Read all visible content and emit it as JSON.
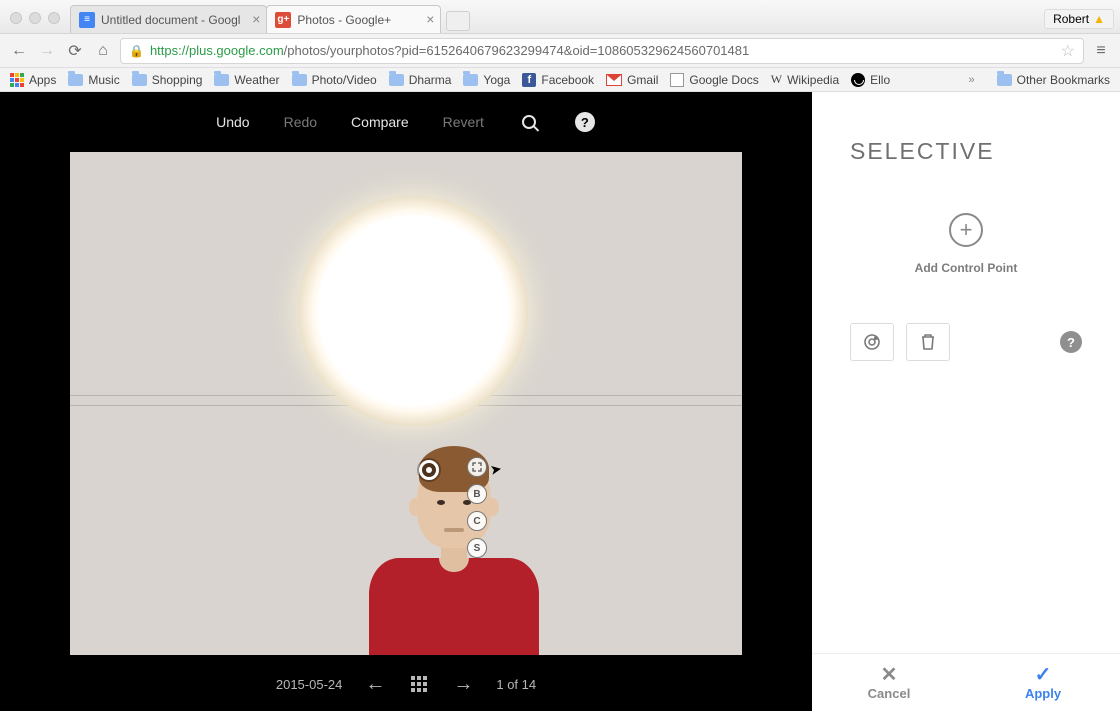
{
  "browser": {
    "tabs": [
      {
        "title": "Untitled document - Googl",
        "active": false,
        "fav": "doc"
      },
      {
        "title": "Photos - Google+",
        "active": true,
        "fav": "gplus"
      }
    ],
    "profile_name": "Robert",
    "url_scheme": "https",
    "url_host": "://plus.google.com",
    "url_path": "/photos/yourphotos?pid=6152640679623299474&oid=108605329624560701481"
  },
  "bookmarks": {
    "apps": "Apps",
    "items": [
      "Music",
      "Shopping",
      "Weather",
      "Photo/Video",
      "Dharma",
      "Yoga"
    ],
    "facebook": "Facebook",
    "gmail": "Gmail",
    "google_docs": "Google Docs",
    "wikipedia": "Wikipedia",
    "ello": "Ello",
    "other": "Other Bookmarks",
    "overflow": "»"
  },
  "toolbar": {
    "undo": "Undo",
    "redo": "Redo",
    "compare": "Compare",
    "revert": "Revert"
  },
  "footer": {
    "date": "2015-05-24",
    "position": "1 of 14"
  },
  "selective": {
    "title": "SELECTIVE",
    "add_label": "Add Control Point",
    "cancel": "Cancel",
    "apply": "Apply"
  },
  "control_points": {
    "options": [
      "B",
      "C",
      "S"
    ]
  }
}
